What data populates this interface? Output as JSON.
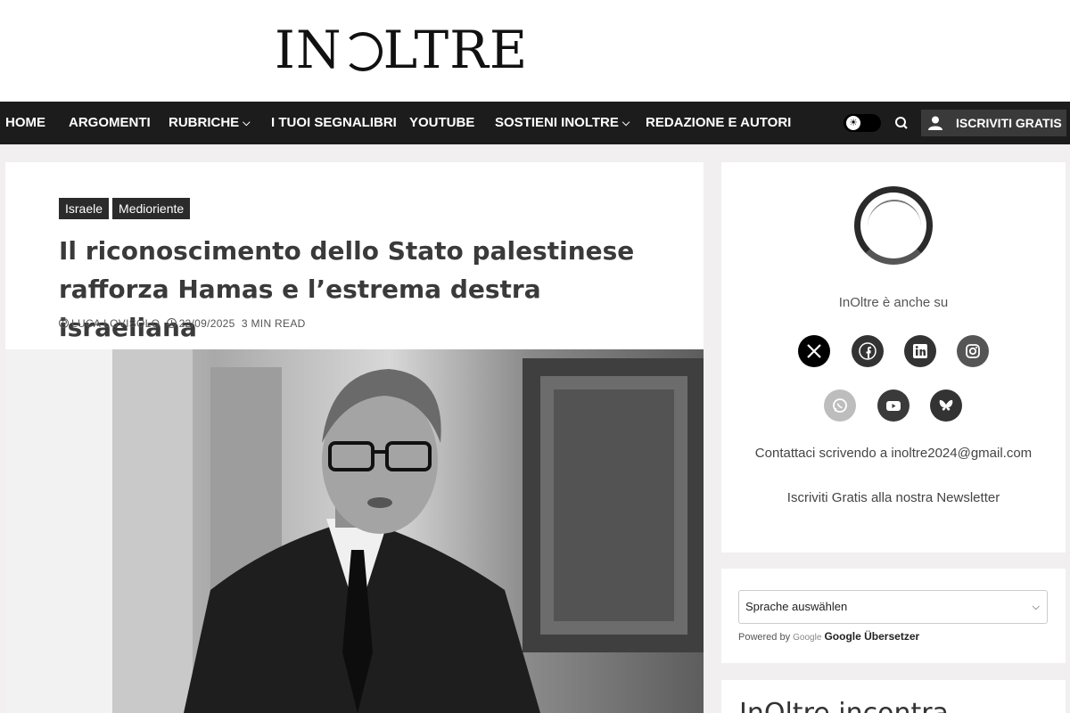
{
  "header": {
    "logo": "INOLTRE"
  },
  "nav": {
    "items": [
      {
        "label": "HOME",
        "dropdown": false
      },
      {
        "label": "ARGOMENTI",
        "dropdown": false
      },
      {
        "label": "RUBRICHE",
        "dropdown": true
      },
      {
        "label": "I TUOI SEGNALIBRI",
        "dropdown": false
      },
      {
        "label": "YOUTUBE",
        "dropdown": false
      },
      {
        "label": "SOSTIENI INOLTRE",
        "dropdown": true
      },
      {
        "label": "REDAZIONE E AUTORI",
        "dropdown": false
      }
    ],
    "subscribe_label": "ISCRIVITI GRATIS"
  },
  "article": {
    "tags": [
      "Israele",
      "Medioriente"
    ],
    "title": "Il riconoscimento dello Stato palestinese rafforza Hamas e l’estrema destra israeliana",
    "author": "LUCA LOVISOLO",
    "date": "22/09/2025",
    "read_time": "3 MIN READ"
  },
  "sidebar": {
    "also_on": "InOltre è anche su",
    "social": [
      "x-icon",
      "facebook-icon",
      "linkedin-icon",
      "instagram-icon",
      "whatsapp-icon",
      "youtube-icon",
      "bluesky-icon"
    ],
    "contact": "Contattaci scrivendo a inoltre2024@gmail.com",
    "newsletter": "Iscriviti Gratis alla nostra Newsletter",
    "language_select": "Sprache auswählen",
    "powered_by": "Powered by",
    "google": "Google",
    "translator": "Google Übersetzer",
    "next_widget_title": "InOltre incontra"
  },
  "colors": {
    "nav_bg": "#1c1c1c",
    "tag_bg": "#2b2b2b",
    "page_bg": "#f1efef"
  }
}
